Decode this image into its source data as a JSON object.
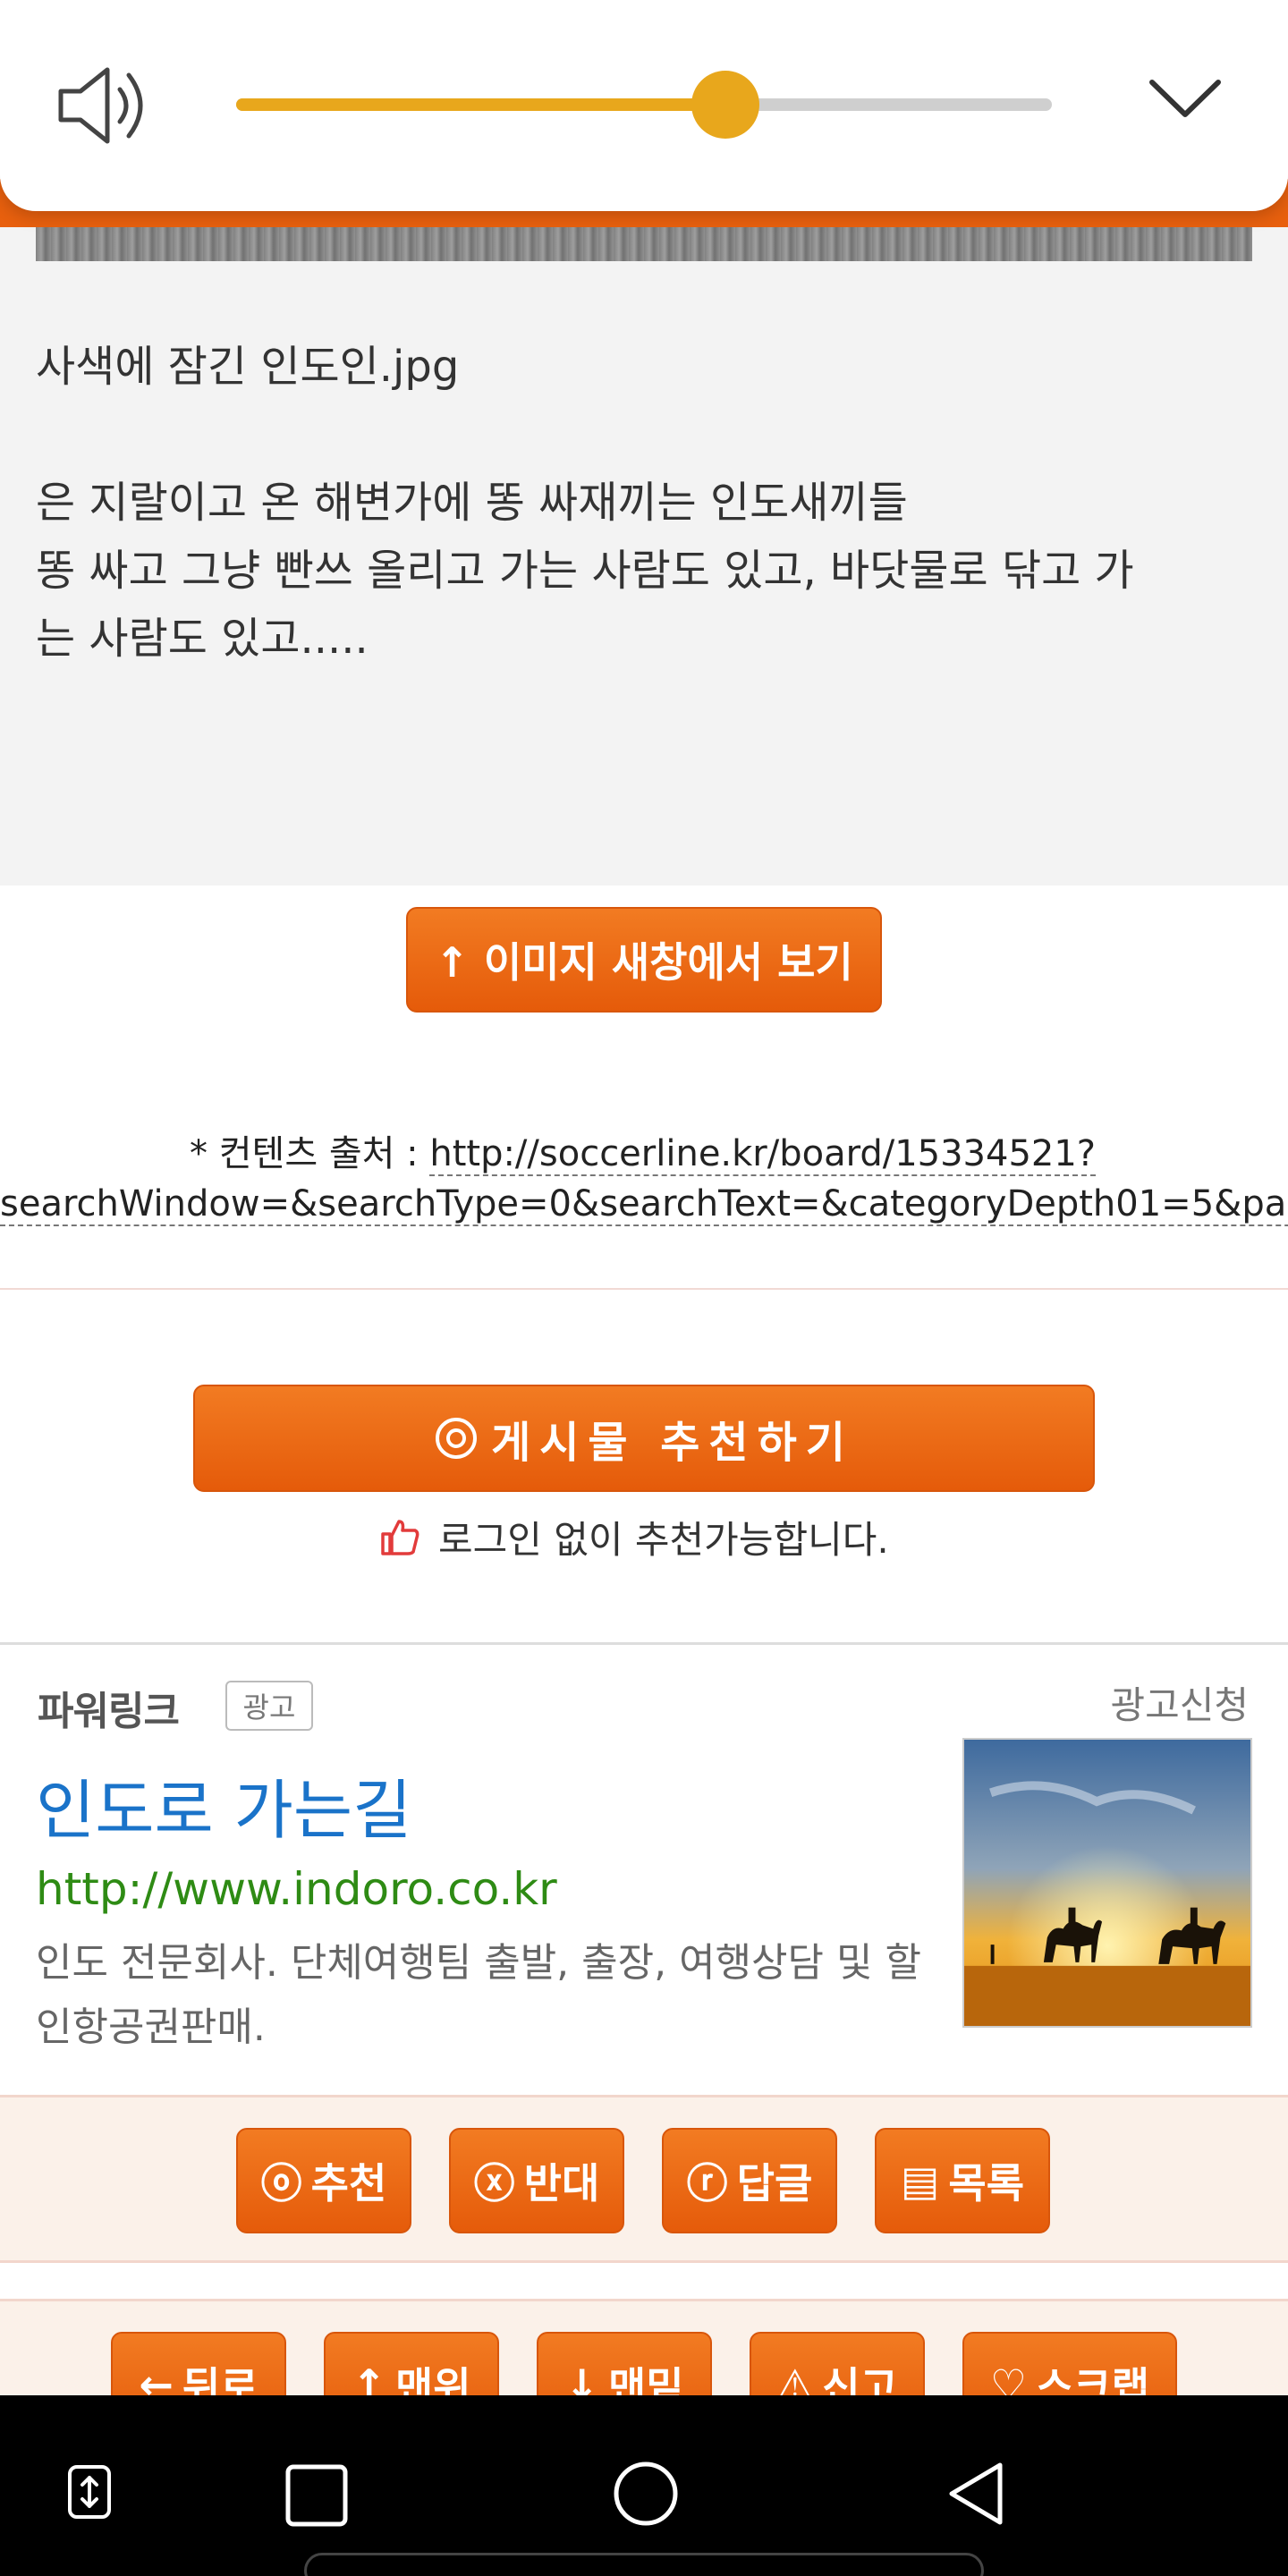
{
  "volume": {
    "level_fraction": 0.6,
    "accent_color": "#e8a71c",
    "icons": [
      "speaker-icon",
      "chevron-down-icon"
    ]
  },
  "article": {
    "image_caption": "사색에 잠긴 인도인.jpg",
    "body_lines": [
      "은 지랄이고 온 해변가에 똥 싸재끼는 인도새끼들",
      "똥 싸고 그냥 빤쓰 올리고 가는 사람도 있고, 바닷물로 닦고 가",
      "는 사람도 있고....."
    ]
  },
  "image_window_button": {
    "label": "↑ 이미지 새창에서 보기"
  },
  "source": {
    "prefix": "* 컨텐츠 출처 : ",
    "link_line1": "http://soccerline.kr/board/15334521?",
    "link_line2": "searchWindow=&searchType=0&searchText=&categoryDepth01=5&page="
  },
  "recommend": {
    "button_label": "게시물 추천하기",
    "note": "로그인 없이 추천가능합니다."
  },
  "ad": {
    "brand": "파워링크",
    "badge": "광고",
    "apply": "광고신청",
    "title": "인도로 가는길",
    "url": "http://www.indoro.co.kr",
    "desc": "인도 전문회사. 단체여행팀 출발, 출장, 여행상담 및 할인항공권판매."
  },
  "actions_row1": [
    {
      "icon": "ⓞ",
      "label": "추천"
    },
    {
      "icon": "ⓧ",
      "label": "반대"
    },
    {
      "icon": "ⓡ",
      "label": "답글"
    },
    {
      "icon": "▤",
      "label": "목록"
    }
  ],
  "actions_row2": [
    {
      "icon": "←",
      "label": "뒤로"
    },
    {
      "icon": "↑",
      "label": "맨위"
    },
    {
      "icon": "↓",
      "label": "맨밑"
    },
    {
      "icon": "⚠",
      "label": "신고"
    },
    {
      "icon": "♡",
      "label": "스크랩"
    }
  ],
  "brand_color": "#e8600e"
}
